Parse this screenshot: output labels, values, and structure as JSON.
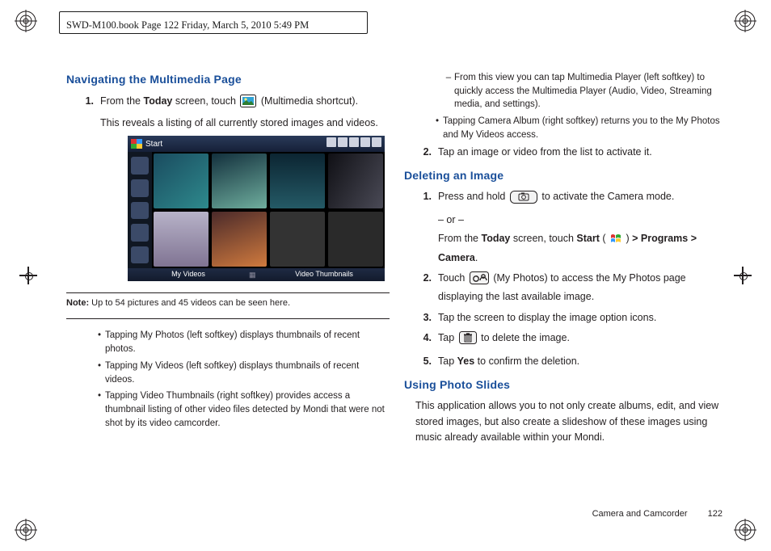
{
  "header": {
    "text": "SWD-M100.book  Page 122  Friday, March 5, 2010  5:49 PM"
  },
  "sections": {
    "nav": {
      "title": "Navigating the Multimedia Page",
      "step1_a": "From the ",
      "step1_b": "Today",
      "step1_c": " screen, touch ",
      "step1_d": " (Multimedia shortcut).",
      "step1_e": "This reveals a listing of all currently stored images and videos.",
      "note_label": "Note:",
      "note_text": " Up to 54 pictures and 45 videos can be seen here.",
      "bul1": "Tapping My Photos (left softkey) displays thumbnails of recent photos.",
      "bul2": "Tapping My Videos (left softkey) displays thumbnails of recent videos.",
      "bul3": "Tapping Video Thumbnails (right softkey) provides access a thumbnail listing of other video files detected by Mondi that were not shot by its video camcorder."
    },
    "nav_right": {
      "dash": "From this view you can tap Multimedia Player (left softkey) to quickly access the Multimedia Player (Audio, Video, Streaming media, and settings).",
      "bul": "Tapping Camera Album (right softkey) returns you to the My Photos and My Videos access.",
      "step2": "Tap an image or video from the list to activate it."
    },
    "del": {
      "title": "Deleting an Image",
      "s1a": "Press and hold ",
      "s1b": " to activate the Camera mode.",
      "s1c": "– or –",
      "s1d_a": "From the ",
      "s1d_b": "Today",
      "s1d_c": " screen, touch ",
      "s1d_d": "Start",
      "s1d_e": " ( ",
      "s1d_f": " ) ",
      "s1d_g": "> Programs > Camera",
      "s1d_h": ".",
      "s2a": "Touch ",
      "s2b": " (My Photos) to access the My Photos page displaying the last available image.",
      "s3": "Tap the screen to display the image option icons.",
      "s4a": "Tap ",
      "s4b": " to delete the image.",
      "s5a": "Tap ",
      "s5b": "Yes",
      "s5c": " to confirm the deletion."
    },
    "slides": {
      "title": "Using Photo Slides",
      "p": "This application allows you to not only create albums, edit, and view stored images, but also create a slideshow of these images using music already available within your Mondi."
    }
  },
  "screenshot": {
    "start": "Start",
    "left_softkey": "My Videos",
    "right_softkey": "Video Thumbnails"
  },
  "footer": {
    "section": "Camera and Camcorder",
    "page": "122"
  }
}
